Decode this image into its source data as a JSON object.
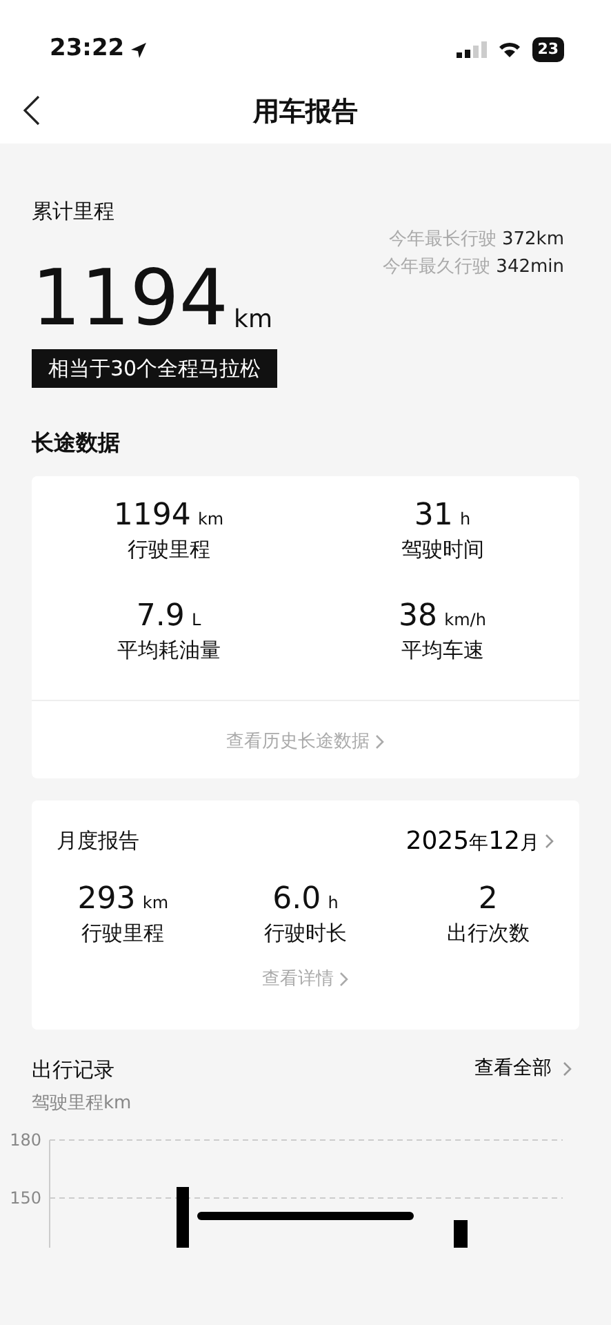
{
  "status_bar": {
    "time": "23:22",
    "battery": "23"
  },
  "header": {
    "title": "用车报告"
  },
  "total": {
    "label": "累计里程",
    "value": "1194",
    "unit": "km",
    "badge": "相当于30个全程马拉松",
    "records": [
      {
        "label": "今年最长行驶",
        "value": "372km"
      },
      {
        "label": "今年最久行驶",
        "value": "342min"
      }
    ]
  },
  "long_trip": {
    "title": "长途数据",
    "stats": [
      {
        "value": "1194",
        "unit": "km",
        "label": "行驶里程"
      },
      {
        "value": "31",
        "unit": "h",
        "label": "驾驶时间"
      },
      {
        "value": "7.9",
        "unit": "L",
        "label": "平均耗油量"
      },
      {
        "value": "38",
        "unit": "km/h",
        "label": "平均车速"
      }
    ],
    "link": "查看历史长途数据"
  },
  "monthly": {
    "title": "月度报告",
    "year": "2025",
    "year_unit": "年",
    "month": "12",
    "month_unit": "月",
    "stats": [
      {
        "value": "293",
        "unit": "km",
        "label": "行驶里程"
      },
      {
        "value": "6.0",
        "unit": "h",
        "label": "行驶时长"
      },
      {
        "value": "2",
        "label": "出行次数"
      }
    ],
    "link": "查看详情"
  },
  "trips": {
    "title": "出行记录",
    "link": "查看全部",
    "ylabel": "驾驶里程km",
    "yticks": [
      "180",
      "150"
    ]
  }
}
